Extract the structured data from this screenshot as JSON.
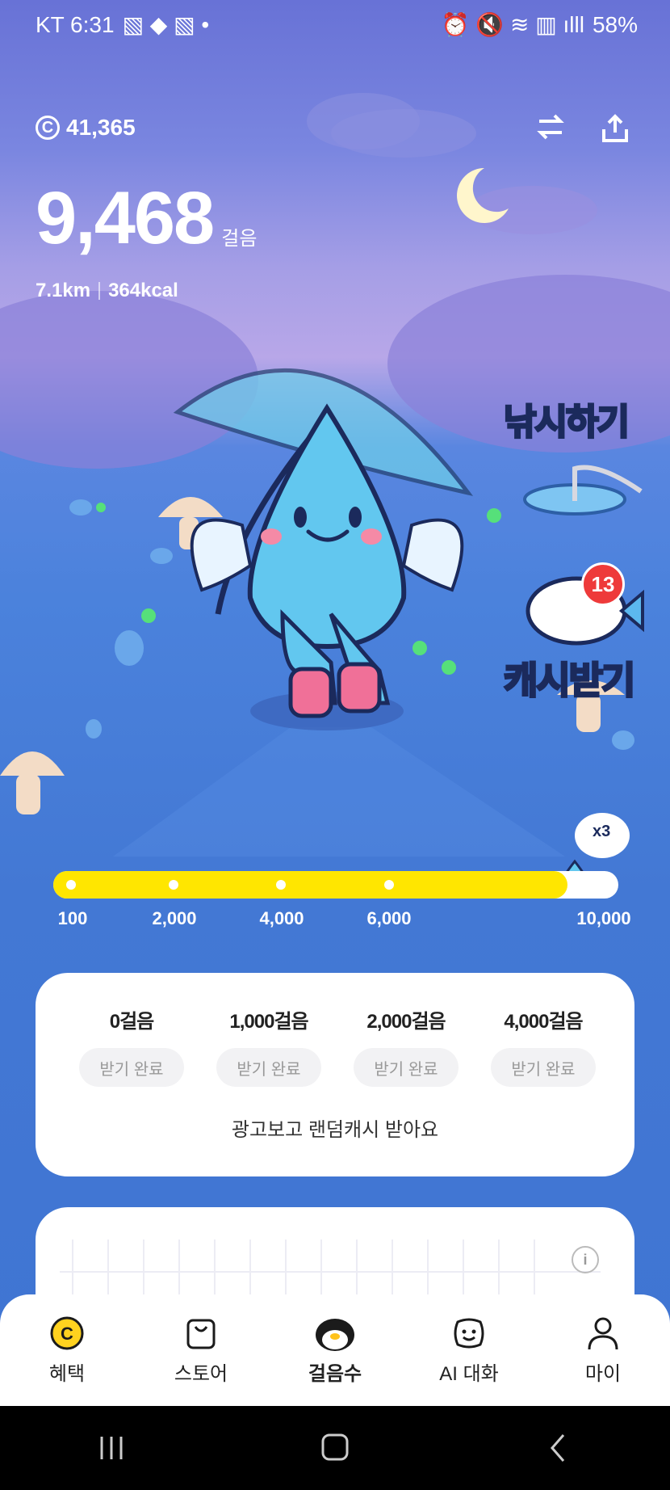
{
  "status": {
    "carrier_time": "KT 6:31",
    "battery": "58%"
  },
  "header": {
    "coins": "41,365"
  },
  "steps": {
    "count": "9,468",
    "unit": "걸음",
    "distance": "7.1km",
    "calories": "364kcal"
  },
  "side_buttons": {
    "fishing": "낚시하기",
    "cash": "캐시받기",
    "cash_badge": "13",
    "fish_multiplier": "x3"
  },
  "progress": {
    "current_steps": 9468,
    "max_steps": 10000,
    "fill_fraction": 0.91,
    "ticks": [
      "100",
      "2,000",
      "4,000",
      "6,000",
      "10,000"
    ]
  },
  "rewards": {
    "milestones": [
      {
        "label": "0걸음",
        "button": "받기 완료"
      },
      {
        "label": "1,000걸음",
        "button": "받기 완료"
      },
      {
        "label": "2,000걸음",
        "button": "받기 완료"
      },
      {
        "label": "4,000걸음",
        "button": "받기 완료"
      }
    ],
    "ad_text": "광고보고 랜덤캐시 받아요"
  },
  "nav": {
    "items": [
      {
        "label": "혜택",
        "icon": "coin-icon"
      },
      {
        "label": "스토어",
        "icon": "shopping-bag-icon"
      },
      {
        "label": "걸음수",
        "icon": "penguin-icon",
        "active": true
      },
      {
        "label": "AI 대화",
        "icon": "ai-chat-icon"
      },
      {
        "label": "마이",
        "icon": "person-icon"
      }
    ]
  },
  "colors": {
    "accent_yellow": "#ffe600",
    "badge_red": "#ee3a3a",
    "sky": "#4378d4"
  }
}
